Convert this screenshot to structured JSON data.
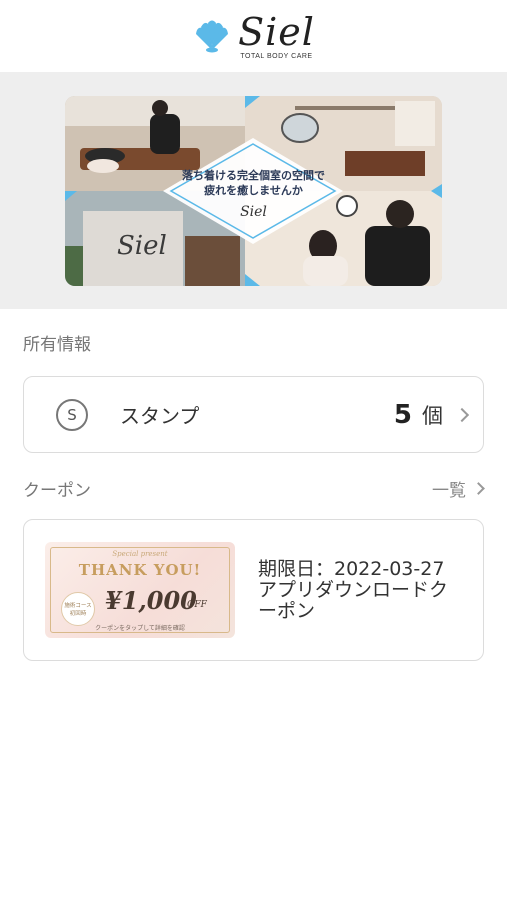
{
  "header": {
    "logo_word": "Siel",
    "logo_sub": "TOTAL BODY CARE"
  },
  "banner": {
    "copy_line1": "落ち着ける完全個室の空間で",
    "copy_line2": "疲れを癒しませんか",
    "logo_word": "Siel",
    "sign_word": "Siel"
  },
  "owned": {
    "title": "所有情報",
    "stamp": {
      "icon": "stamp-s-icon",
      "icon_glyph": "S",
      "label": "スタンプ",
      "count": "5",
      "unit": "個"
    }
  },
  "coupons": {
    "title": "クーポン",
    "list_link": "一覧",
    "items": [
      {
        "expiry": "期限日：2022-03-27",
        "name": "アプリダウンロードクーポン",
        "thumb": {
          "special": "Special present",
          "title": "THANK YOU!",
          "badge_line1": "施術コース",
          "badge_line2": "初回時",
          "amount": "¥1,000",
          "off": "OFF",
          "note": "クーポンをタップして詳細を確認"
        }
      }
    ]
  },
  "colors": {
    "brand_blue": "#5bb9e8",
    "background": "#ffffff",
    "banner_bg": "#eeeeee",
    "gold": "#c79d5e"
  }
}
